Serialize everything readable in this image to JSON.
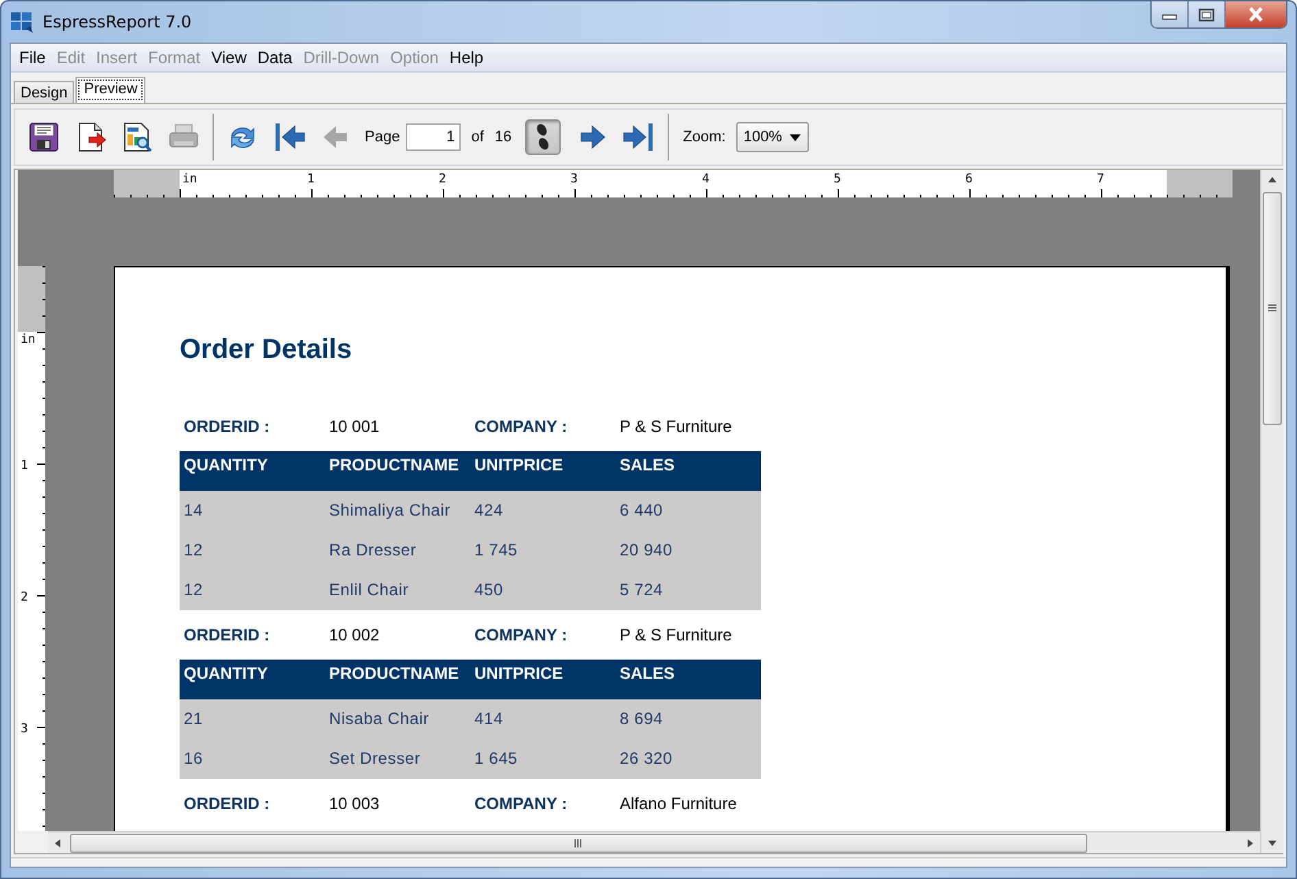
{
  "window": {
    "title": "EspressReport 7.0"
  },
  "menu": [
    {
      "label": "File",
      "disabled": false
    },
    {
      "label": "Edit",
      "disabled": true
    },
    {
      "label": "Insert",
      "disabled": true
    },
    {
      "label": "Format",
      "disabled": true
    },
    {
      "label": "View",
      "disabled": false
    },
    {
      "label": "Data",
      "disabled": false
    },
    {
      "label": "Drill-Down",
      "disabled": true
    },
    {
      "label": "Option",
      "disabled": true
    },
    {
      "label": "Help",
      "disabled": false
    }
  ],
  "tabs": [
    {
      "label": "Design",
      "selected": false
    },
    {
      "label": "Preview",
      "selected": true
    }
  ],
  "toolbar": [
    {
      "kind": "save",
      "disabled": false
    },
    {
      "kind": "export",
      "disabled": false
    },
    {
      "kind": "report",
      "disabled": false
    },
    {
      "kind": "print",
      "disabled": true
    },
    {
      "kind": "separator"
    },
    {
      "kind": "refresh",
      "disabled": false
    },
    {
      "kind": "first",
      "disabled": false
    },
    {
      "kind": "previous",
      "disabled": true
    },
    {
      "kind": "page",
      "label": "Page",
      "value": "1",
      "of": "of",
      "total": "16"
    },
    {
      "kind": "steps",
      "pressed": true
    },
    {
      "kind": "next",
      "disabled": false
    },
    {
      "kind": "last",
      "disabled": false
    },
    {
      "kind": "separator"
    },
    {
      "kind": "zoom",
      "label": "Zoom:",
      "value": "100%"
    }
  ],
  "ruler": {
    "horizontal_labels": [
      "in",
      "1",
      "2",
      "3",
      "4",
      "5",
      "6",
      "7"
    ],
    "vertical_labels": [
      "in",
      "1",
      "2",
      "3"
    ]
  },
  "report": {
    "title": "Order Details",
    "orders": [
      {
        "orderid_label": "ORDERID :",
        "orderid": "10 001",
        "company_label": "COMPANY :",
        "company": "P & S Furniture",
        "columns": [
          "QUANTITY",
          "PRODUCTNAME",
          "UNITPRICE",
          "SALES"
        ],
        "rows": [
          [
            "14",
            "Shimaliya Chair",
            "424",
            "6 440"
          ],
          [
            "12",
            "Ra Dresser",
            "1 745",
            "20 940"
          ],
          [
            "12",
            "Enlil Chair",
            "450",
            "5 724"
          ]
        ]
      },
      {
        "orderid_label": "ORDERID :",
        "orderid": "10 002",
        "company_label": "COMPANY :",
        "company": "P & S Furniture",
        "columns": [
          "QUANTITY",
          "PRODUCTNAME",
          "UNITPRICE",
          "SALES"
        ],
        "rows": [
          [
            "21",
            "Nisaba Chair",
            "414",
            "8 694"
          ],
          [
            "16",
            "Set Dresser",
            "1 645",
            "26 320"
          ]
        ]
      },
      {
        "orderid_label": "ORDERID :",
        "orderid": "10 003",
        "company_label": "COMPANY :",
        "company": "Alfano Furniture"
      }
    ]
  }
}
